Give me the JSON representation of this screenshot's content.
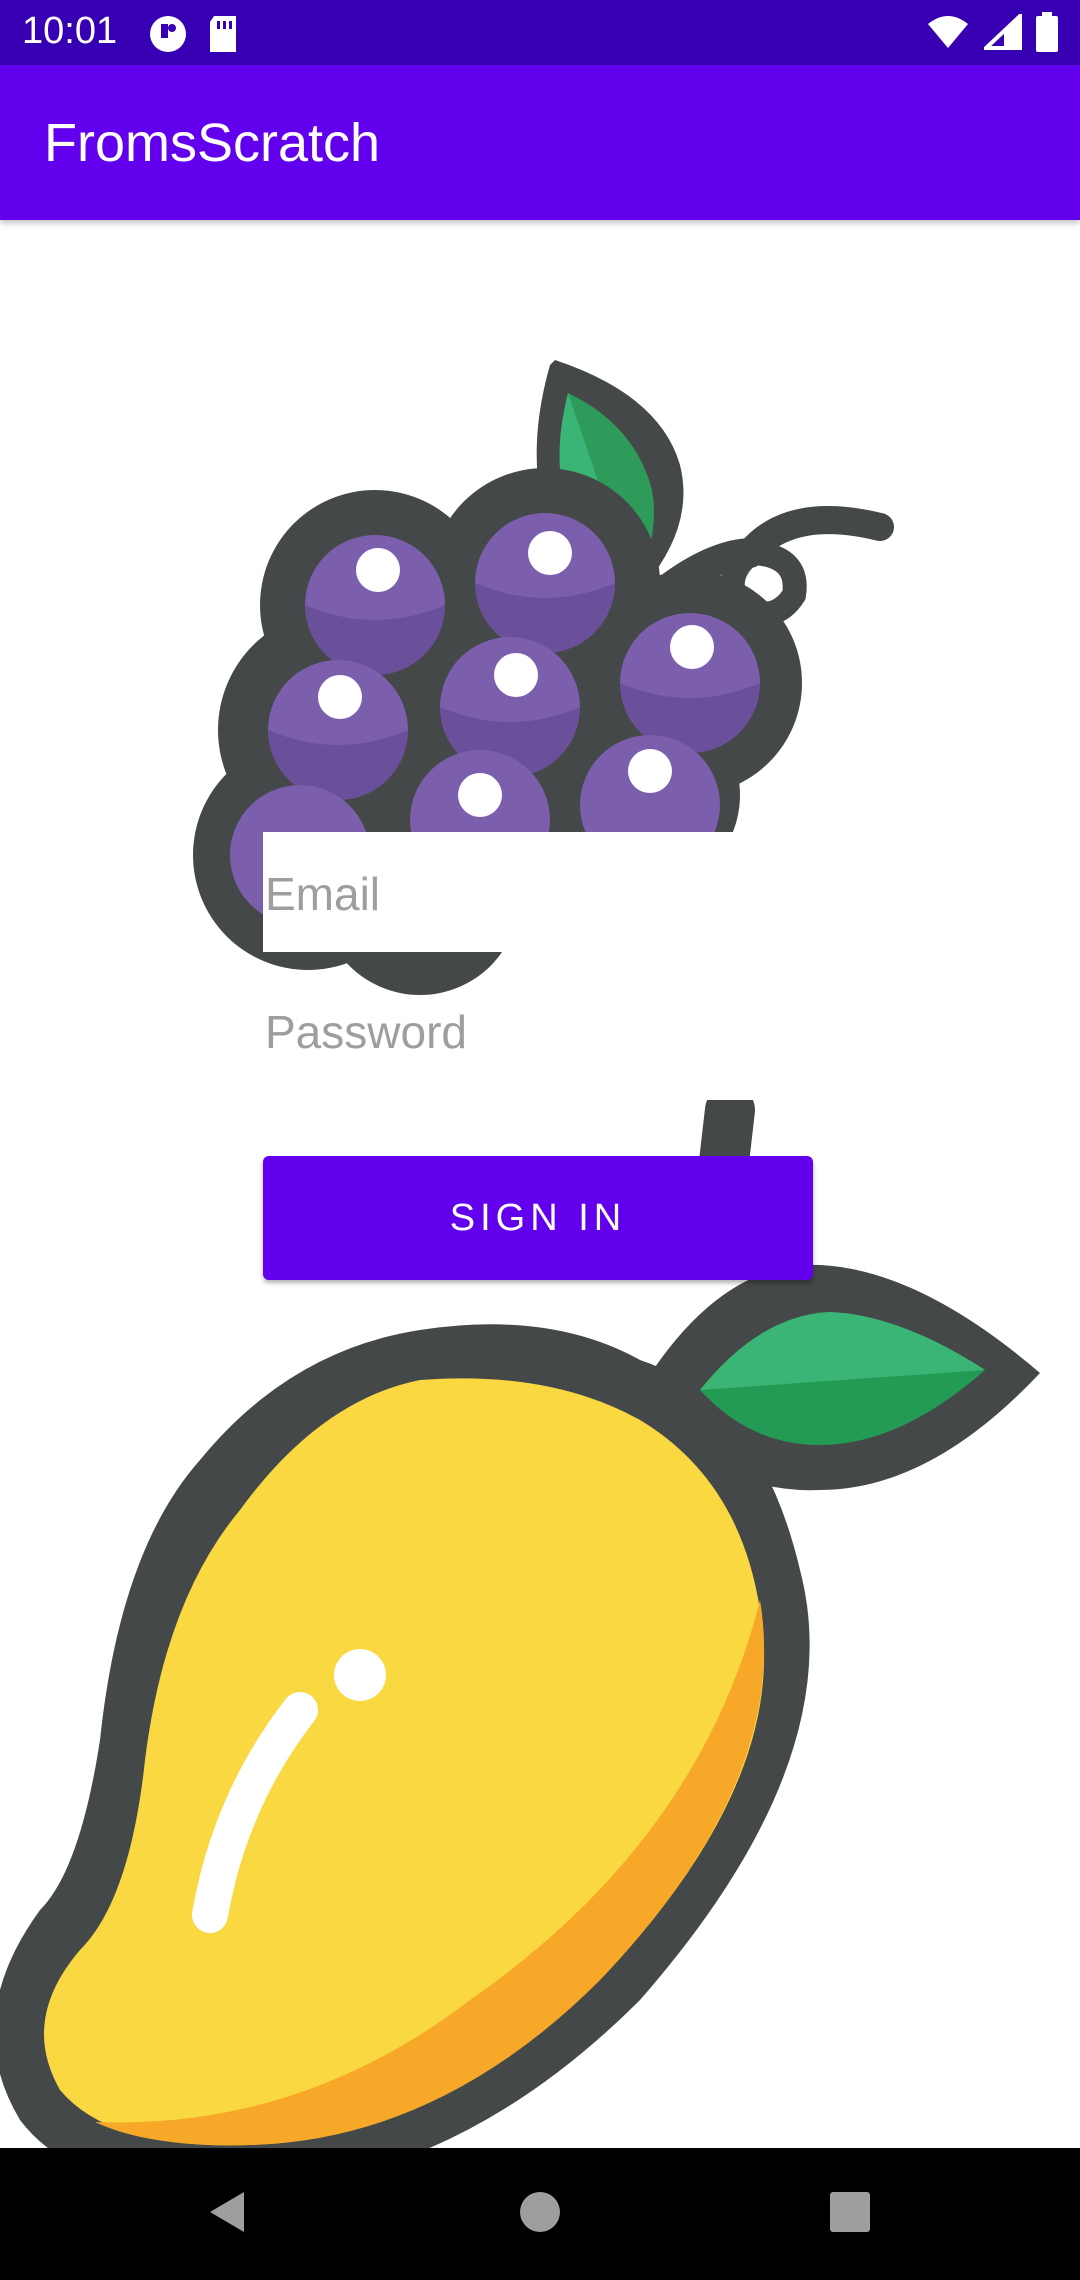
{
  "status_bar": {
    "time": "10:01",
    "left_icons": [
      "app-notification-icon",
      "sd-card-icon"
    ],
    "right_icons": [
      "wifi-icon",
      "cell-signal-icon",
      "battery-icon"
    ]
  },
  "app_bar": {
    "title": "FromsScratch"
  },
  "form": {
    "email_placeholder": "Email",
    "password_placeholder": "Password",
    "sign_in_label": "SIGN IN"
  },
  "illustrations": [
    "grapes-illustration",
    "mango-illustration"
  ],
  "nav_bar": {
    "buttons": [
      "back-icon",
      "home-icon",
      "recents-icon"
    ]
  },
  "colors": {
    "status_bar": "#3700b3",
    "primary": "#6200ee",
    "grape_purple": "#7b5fad",
    "mango_yellow": "#f9d841",
    "mango_orange": "#f7a828",
    "leaf_green": "#3bb575",
    "outline": "#454849"
  }
}
